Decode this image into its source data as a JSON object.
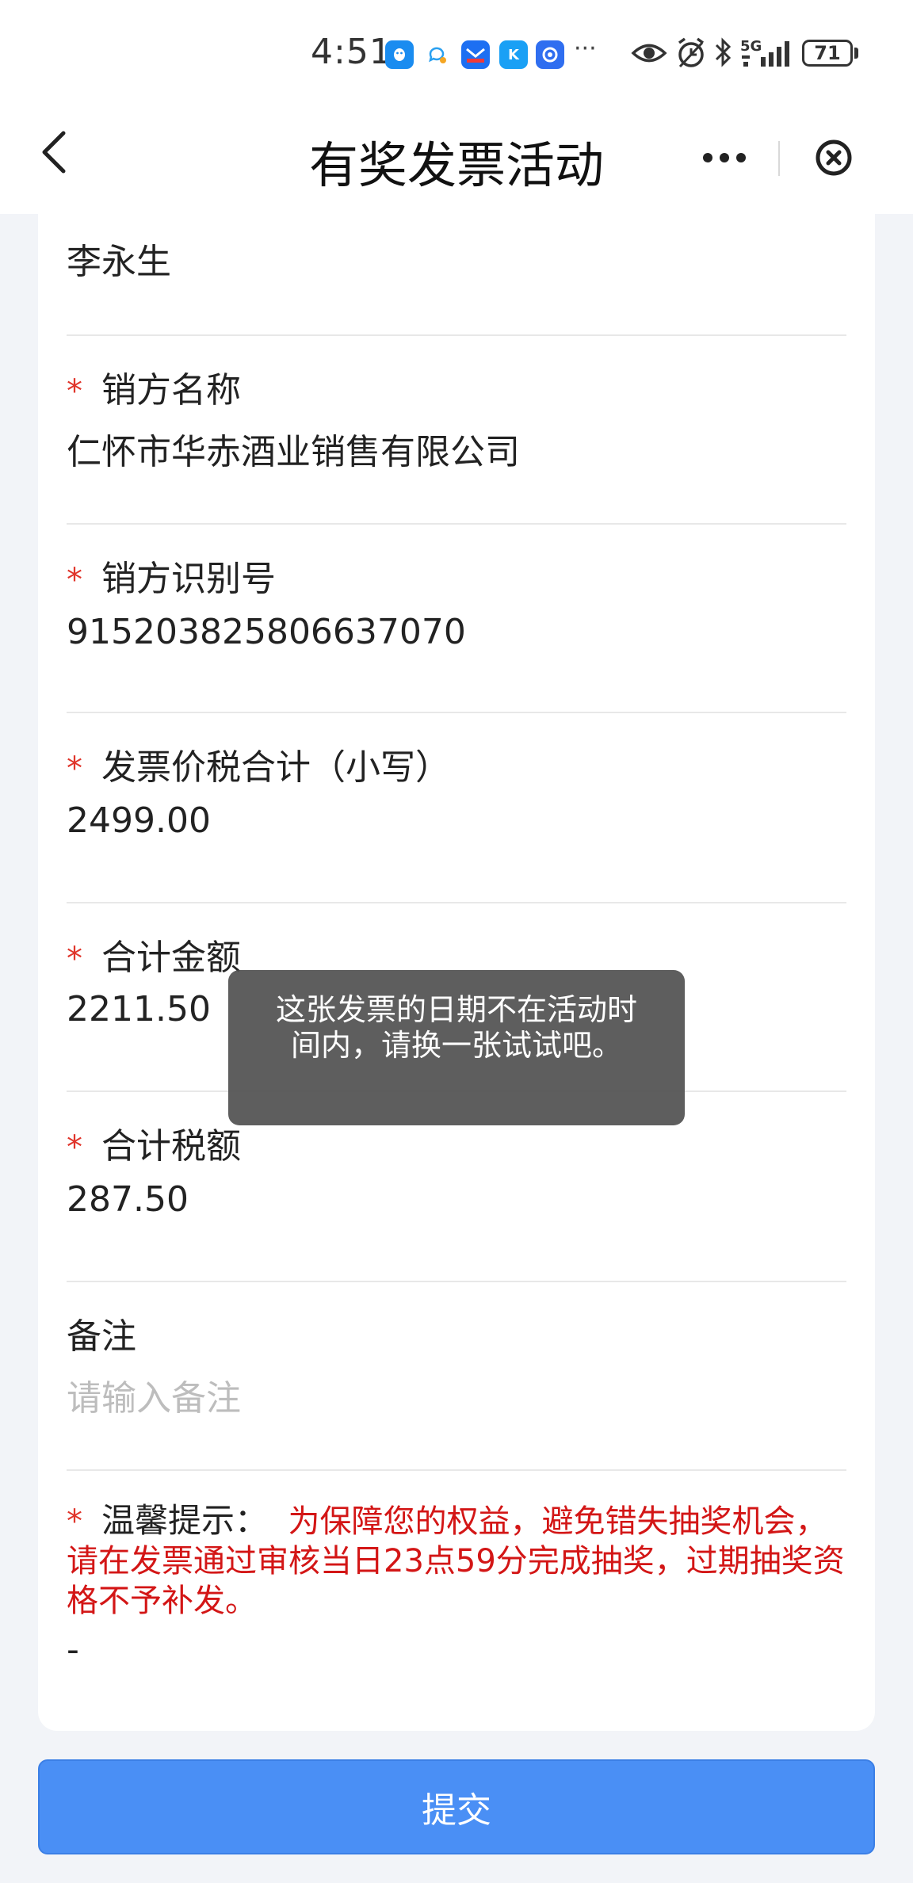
{
  "status_bar": {
    "time": "4:51",
    "more_indicator": "···",
    "network": "5G",
    "battery": "71"
  },
  "nav": {
    "title": "有奖发票活动"
  },
  "form": {
    "buyer_name_value": "李永生",
    "seller_name": {
      "label": "销方名称",
      "value": "仁怀市华赤酒业销售有限公司",
      "required": "*"
    },
    "seller_tax_id": {
      "label": "销方识别号",
      "value": "915203825806637070",
      "required": "*"
    },
    "total_with_tax": {
      "label": "发票价税合计（小写）",
      "value": "2499.00",
      "required": "*"
    },
    "total_amount": {
      "label": "合计金额",
      "value": "2211.50",
      "required": "*"
    },
    "total_tax": {
      "label": "合计税额",
      "value": "287.50",
      "required": "*"
    },
    "remark": {
      "label": "备注",
      "placeholder": "请输入备注"
    },
    "tip": {
      "required": "*",
      "label": "温馨提示：",
      "text": "为保障您的权益，避免错失抽奖机会，请在发票通过审核当日23点59分完成抽奖，过期抽奖资格不予补发。",
      "dash": "-"
    }
  },
  "toast": {
    "message": "这张发票的日期不在活动时间内，请换一张试试吧。"
  },
  "submit": {
    "label": "提交"
  },
  "colors": {
    "required": "#e0352b",
    "tip_text": "#d31616",
    "submit_bg": "#4a8ff5",
    "page_bg": "#f2f4f8"
  },
  "icons": [
    "back-arrow-icon",
    "more-dots-icon",
    "close-circle-icon",
    "eye-icon",
    "alarm-icon",
    "bluetooth-icon",
    "signal-icon",
    "battery-icon"
  ]
}
